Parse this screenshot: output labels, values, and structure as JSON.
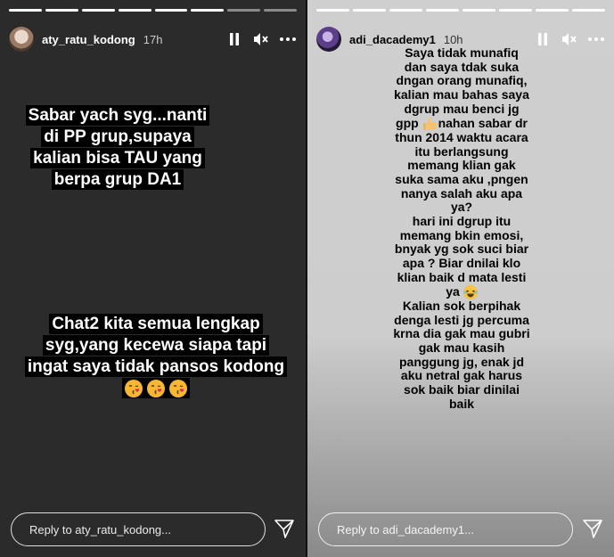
{
  "left_story": {
    "username": "aty_ratu_kodong",
    "time": "17h",
    "progress": {
      "segments": 8,
      "done": 6
    },
    "caption_top": [
      "Sabar yach syg...nanti",
      "di PP grup,supaya",
      "kalian bisa TAU yang",
      "berpa grup DA1"
    ],
    "caption_bottom": [
      "Chat2 kita semua lengkap",
      "syg,yang kecewa siapa tapi",
      "ingat saya tidak pansos kodong"
    ],
    "emojis": [
      "kissing-face",
      "kissing-face",
      "kissing-face"
    ],
    "reply_placeholder": "Reply to aty_ratu_kodong..."
  },
  "right_story": {
    "username": "adi_dacademy1",
    "time": "10h",
    "progress": {
      "segments": 8,
      "done": 8
    },
    "text_part1": "Saya tidak munafiq\ndan saya tdak suka\ndngan orang munafiq,\nkalian mau bahas saya\ndgrup mau benci jg\ngpp",
    "text_part1_emoji": "thumbs-up",
    "text_part2": "nahan sabar dr\nthun 2014 waktu acara\nitu berlangsung\nmemang klian gak\nsuka sama aku ,pngen\nnanya salah aku apa\nya?\nhari ini dgrup itu\nmemang bkin emosi,\nbnyak yg sok suci biar\napa  ? Biar dnilai klo\nklian baik d mata lesti\nya",
    "text_part2_emoji": "laughing-face",
    "text_part3": "Kalian sok berpihak\ndenga lesti jg percuma\nkrna dia gak mau gubri\ngak mau kasih\npanggung jg, enak jd\naku netral gak harus\nsok baik biar dinilai\nbaik",
    "reply_placeholder": "Reply to adi_dacademy1..."
  }
}
